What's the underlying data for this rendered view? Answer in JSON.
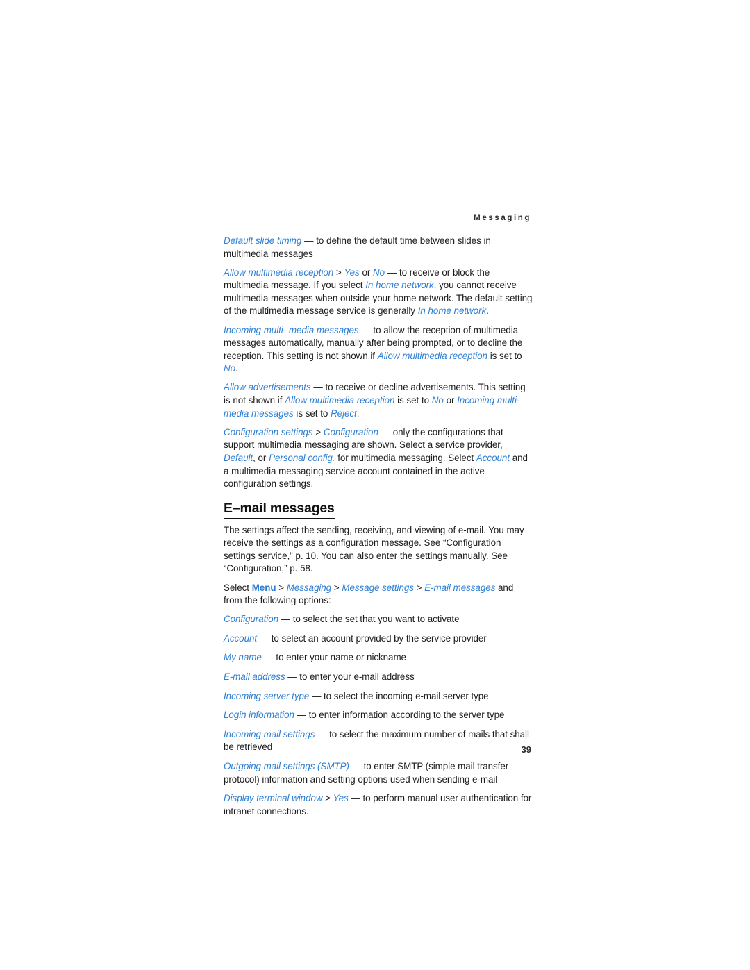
{
  "document": {
    "running_head": "Messaging",
    "page_number": "39",
    "accent_color": "#2e7fd4",
    "text_color": "#1c1c1c"
  },
  "section_mms": {
    "default_slide_timing": {
      "term": "Default slide timing",
      "dash": " — ",
      "body_1": "to define the default time between slides in multimedia messages"
    },
    "allow_multimedia_reception": {
      "term": "Allow multimedia reception",
      "gt_1": " > ",
      "value_yes": "Yes",
      "conj_or": " or ",
      "value_no": "No",
      "dash": " — ",
      "body_1": "to receive or block the multimedia message. If you select ",
      "term_in_home_network_1": "In home network",
      "body_2": ", you cannot receive multimedia messages when outside your home network. The default setting of the multimedia message service is generally ",
      "term_in_home_network_2": "In home network",
      "body_3": "."
    },
    "incoming_multimedia_messages": {
      "term": "Incoming multi- media messages",
      "dash": " — ",
      "body_1": "to allow the reception of multimedia messages automatically, manually after being prompted, or to decline the reception. This setting is not shown if ",
      "term_allow_reception": "Allow multimedia reception",
      "body_2": " is set to ",
      "value_no": "No",
      "body_3": "."
    },
    "allow_advertisements": {
      "term": "Allow advertisements",
      "dash": " — ",
      "body_1": "to receive or decline advertisements. This setting is not shown if ",
      "term_allow_reception": "Allow multimedia reception",
      "body_2": " is set to ",
      "value_no": "No",
      "body_3": " or ",
      "term_incoming": "Incoming multi- media messages",
      "body_4": " is set to ",
      "value_reject": "Reject",
      "body_5": "."
    },
    "configuration_settings": {
      "term_1": "Configuration settings",
      "gt_1": " > ",
      "term_2": "Configuration",
      "dash": " — ",
      "body_1": "only the configurations that support multimedia messaging are shown. Select a service provider, ",
      "value_default": "Default",
      "body_2": ", or ",
      "value_personal_config": "Personal config.",
      "body_3": " for multimedia messaging. Select ",
      "term_account": "Account",
      "body_4": " and a multimedia messaging service account contained in the active configuration settings."
    }
  },
  "section_email": {
    "heading": "E–mail messages",
    "intro": "The settings affect the sending, receiving, and viewing of e-mail. You may receive the settings as a configuration message. See “Configuration settings service,” p. 10. You can also enter the settings manually. See “Configuration,” p. 58.",
    "path": {
      "select_label": "Select ",
      "menu": "Menu",
      "gt_1": " > ",
      "messaging": "Messaging",
      "gt_2": " > ",
      "message_settings": "Message settings",
      "gt_3": " > ",
      "email_messages": "E-mail messages",
      "tail": " and from the following options:"
    },
    "options": [
      {
        "term": "Configuration",
        "dash": " — ",
        "description": "to select the set that you want to activate"
      },
      {
        "term": "Account",
        "dash": " — ",
        "description": "to select an account provided by the service provider"
      },
      {
        "term": "My name",
        "dash": " — ",
        "description": "to enter your name or nickname"
      },
      {
        "term": "E-mail address",
        "dash": " — ",
        "description": "to enter your e-mail address"
      },
      {
        "term": "Incoming server type",
        "dash": " — ",
        "description": "to select the incoming e-mail server type"
      },
      {
        "term": "Login information",
        "dash": " — ",
        "description": "to enter information according to the server type"
      },
      {
        "term": "Incoming mail settings",
        "dash": " — ",
        "description": "to select the maximum number of mails that shall be retrieved"
      },
      {
        "term": "Outgoing mail settings (SMTP)",
        "dash": " — ",
        "description": "to enter SMTP (simple mail transfer protocol) information and setting options used when sending e-mail"
      },
      {
        "term": "Display terminal window",
        "gt": " > ",
        "value": "Yes",
        "dash": " — ",
        "description": "to perform manual user authentication for intranet connections."
      }
    ]
  }
}
